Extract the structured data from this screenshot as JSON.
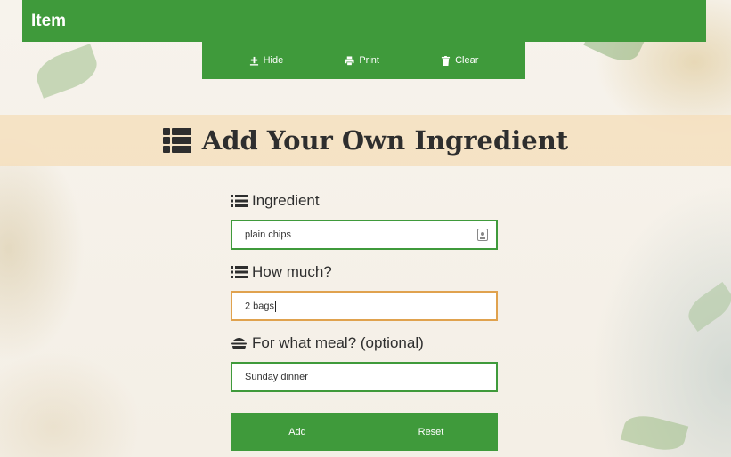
{
  "header": {
    "title": "Item"
  },
  "toolbar": {
    "hide_label": "Hide",
    "print_label": "Print",
    "clear_label": "Clear"
  },
  "banner": {
    "title": "Add Your Own Ingredient"
  },
  "form": {
    "ingredient": {
      "label": "Ingredient",
      "value": "plain chips"
    },
    "quantity": {
      "label": "How much?",
      "value": "2 bags"
    },
    "meal": {
      "label": "For what meal? (optional)",
      "value": "Sunday dinner"
    }
  },
  "actions": {
    "add_label": "Add",
    "reset_label": "Reset"
  },
  "colors": {
    "accent_green": "#3f9a3b",
    "focus_orange": "#e0a24e",
    "banner_bg": "#f5debc"
  }
}
